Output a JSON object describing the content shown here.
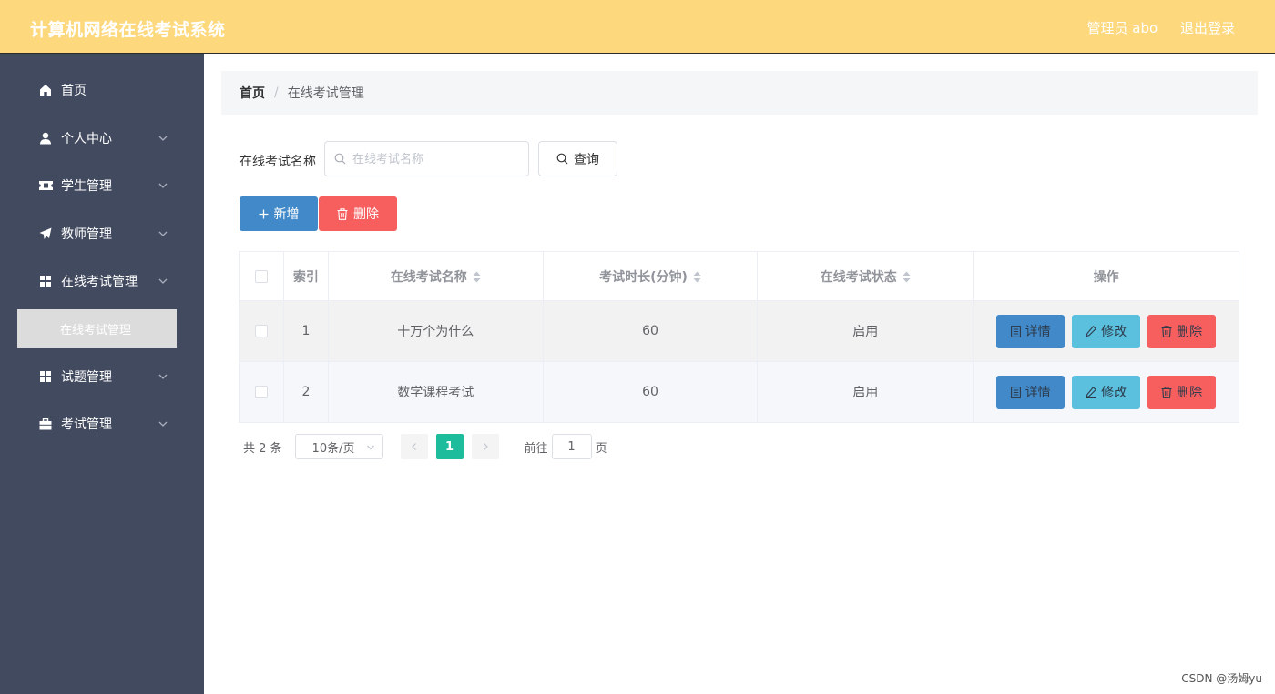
{
  "header": {
    "app_title": "计算机网络在线考试系统",
    "user_label": "管理员 abo",
    "logout_label": "退出登录"
  },
  "sidebar": {
    "items": [
      {
        "label": "首页",
        "icon": "home-icon"
      },
      {
        "label": "个人中心",
        "icon": "user-icon"
      },
      {
        "label": "学生管理",
        "icon": "ticket-icon"
      },
      {
        "label": "教师管理",
        "icon": "send-icon"
      },
      {
        "label": "在线考试管理",
        "icon": "grid-icon"
      },
      {
        "label": "试题管理",
        "icon": "grid-icon"
      },
      {
        "label": "考试管理",
        "icon": "briefcase-icon"
      }
    ],
    "active_submenu": "在线考试管理"
  },
  "breadcrumb": {
    "home": "首页",
    "separator": "/",
    "current": "在线考试管理"
  },
  "search": {
    "label": "在线考试名称",
    "placeholder": "在线考试名称",
    "value": "",
    "button_label": "查询"
  },
  "toolbar": {
    "add_label": "新增",
    "delete_label": "删除"
  },
  "table": {
    "headers": {
      "index": "索引",
      "name": "在线考试名称",
      "duration": "考试时长(分钟)",
      "status": "在线考试状态",
      "actions": "操作"
    },
    "rows": [
      {
        "index": "1",
        "name": "十万个为什么",
        "duration": "60",
        "status": "启用"
      },
      {
        "index": "2",
        "name": "数学课程考试",
        "duration": "60",
        "status": "启用"
      }
    ],
    "action_labels": {
      "detail": "详情",
      "edit": "修改",
      "delete": "删除"
    }
  },
  "pagination": {
    "total_text": "共 2 条",
    "page_size": "10条/页",
    "current_page": "1",
    "jump_prefix": "前往",
    "jump_value": "1",
    "jump_suffix": "页"
  },
  "watermark": "CSDN @汤姆yu",
  "colors": {
    "header_bg": "#fdd87c",
    "sidebar_bg": "#424a5f",
    "primary": "#4189c9",
    "info": "#5bc0de",
    "danger": "#f75f5f",
    "pager_active": "#1cbc9c"
  }
}
